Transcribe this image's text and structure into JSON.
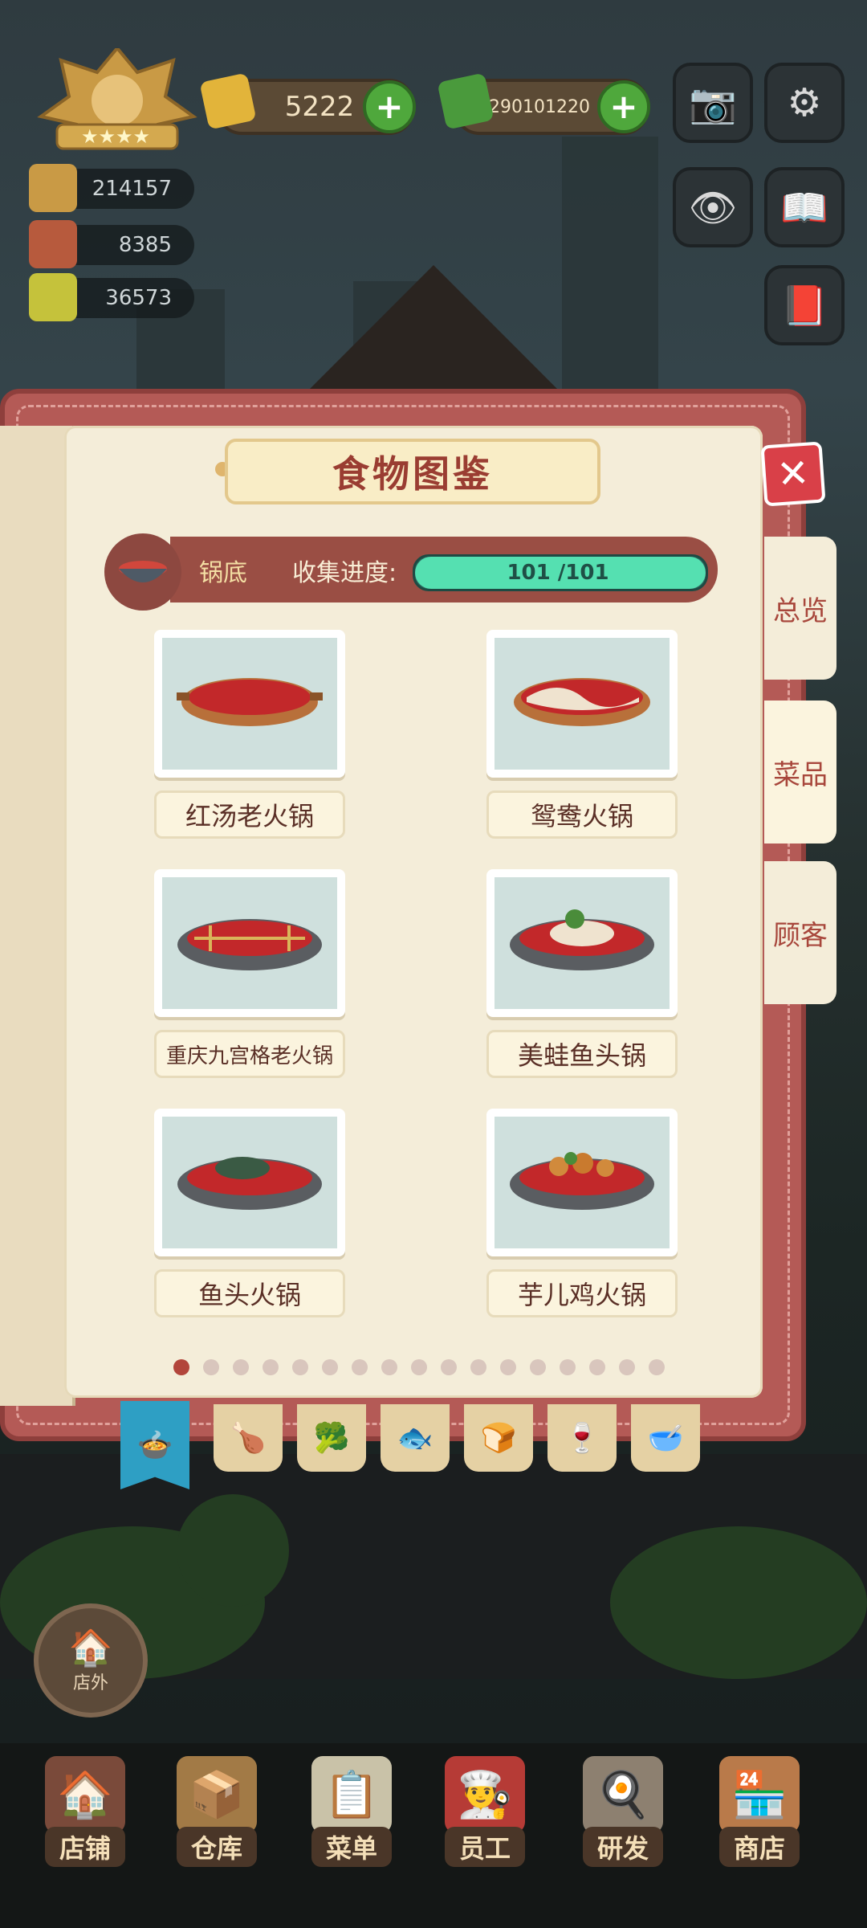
{
  "hud": {
    "gold": "5222",
    "cash": "290101220",
    "stat1": "214157",
    "stat2": "8385",
    "stat3": "36573"
  },
  "book": {
    "title": "食物图鉴",
    "category": "锅底",
    "progress_label": "收集进度:",
    "progress_text": "101 /101",
    "progress_fraction": 1.0,
    "items": [
      {
        "name": "红汤老火锅"
      },
      {
        "name": "鸳鸯火锅"
      },
      {
        "name": "重庆九宫格老火锅"
      },
      {
        "name": "美蛙鱼头锅"
      },
      {
        "name": "鱼头火锅"
      },
      {
        "name": "芋儿鸡火锅"
      }
    ],
    "page_dots": 17,
    "active_page": 1,
    "side_tabs": [
      "总览",
      "菜品",
      "顾客"
    ],
    "active_side_tab": "菜品",
    "category_tabs": [
      "hotpot-icon",
      "drumstick-icon",
      "broccoli-icon",
      "fish-icon",
      "bread-icon",
      "wine-icon",
      "soup-icon"
    ]
  },
  "outside": {
    "label": "店外"
  },
  "nav": [
    "店铺",
    "仓库",
    "菜单",
    "员工",
    "研发",
    "商店"
  ]
}
